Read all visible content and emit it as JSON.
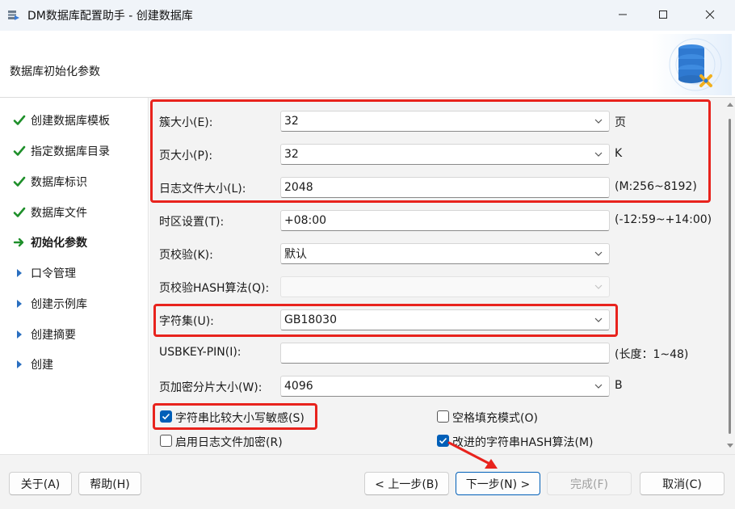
{
  "window": {
    "title": "DM数据库配置助手 - 创建数据库",
    "icon": "db-setup-icon"
  },
  "header": {
    "title": "数据库初始化参数",
    "logo": "database-gear-logo"
  },
  "sidebar": {
    "items": [
      {
        "label": "创建数据库模板",
        "state": "done"
      },
      {
        "label": "指定数据库目录",
        "state": "done"
      },
      {
        "label": "数据库标识",
        "state": "done"
      },
      {
        "label": "数据库文件",
        "state": "done"
      },
      {
        "label": "初始化参数",
        "state": "current"
      },
      {
        "label": "口令管理",
        "state": "pending"
      },
      {
        "label": "创建示例库",
        "state": "pending"
      },
      {
        "label": "创建摘要",
        "state": "pending"
      },
      {
        "label": "创建",
        "state": "pending"
      }
    ]
  },
  "form": {
    "extent_size": {
      "label": "簇大小(E):",
      "value": "32",
      "suffix": "页"
    },
    "page_size": {
      "label": "页大小(P):",
      "value": "32",
      "suffix": "K"
    },
    "log_file_size": {
      "label": "日志文件大小(L):",
      "value": "2048",
      "suffix": "(M:256~8192)"
    },
    "time_zone": {
      "label": "时区设置(T):",
      "value": "+08:00",
      "suffix": "(-12:59~+14:00)"
    },
    "page_check": {
      "label": "页校验(K):",
      "value": "默认"
    },
    "page_check_hash": {
      "label": "页校验HASH算法(Q):",
      "value": ""
    },
    "charset": {
      "label": "字符集(U):",
      "value": "GB18030"
    },
    "usbkey_pin": {
      "label": "USBKEY-PIN(I):",
      "value": "",
      "suffix": "(长度：1~48)"
    },
    "page_encrypt_shard": {
      "label": "页加密分片大小(W):",
      "value": "4096",
      "suffix": "B"
    }
  },
  "checkboxes": {
    "case_sensitive": {
      "label": "字符串比较大小写敏感(S)",
      "checked": true
    },
    "blank_pad_mode": {
      "label": "空格填充模式(O)",
      "checked": false
    },
    "log_encrypt": {
      "label": "启用日志文件加密(R)",
      "checked": false
    },
    "improved_hash": {
      "label": "改进的字符串HASH算法(M)",
      "checked": true
    }
  },
  "footer": {
    "about": "关于(A)",
    "help": "帮助(H)",
    "prev": "< 上一步(B)",
    "next": "下一步(N) >",
    "finish": "完成(F)",
    "cancel": "取消(C)"
  },
  "colors": {
    "highlight": "#e8231d",
    "accent": "#005fb8",
    "check_green": "#1e8f2a",
    "arrow_blue": "#0f6cbd"
  }
}
